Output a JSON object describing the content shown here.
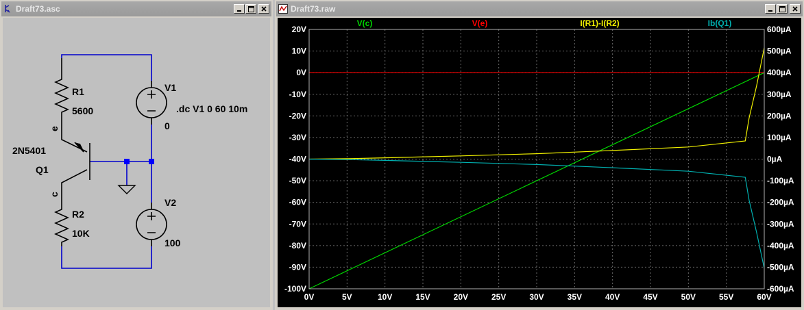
{
  "schematic_window": {
    "title": "Draft73.asc",
    "icon": "ltspice-app-icon",
    "buttons": [
      "minimize-icon",
      "maximize-icon",
      "close-icon"
    ],
    "components": {
      "r1_name": "R1",
      "r1_value": "5600",
      "r2_name": "R2",
      "r2_value": "10K",
      "v1_name": "V1",
      "v1_value": "0",
      "v2_name": "V2",
      "v2_value": "100",
      "q1_model": "2N5401",
      "q1_name": "Q1",
      "emitter_net": "e",
      "collector_net": "c",
      "directive": ".dc V1 0 60 10m"
    },
    "colors": {
      "background": "#c0c0c0",
      "wire": "#0000cc",
      "junction": "#0000ff",
      "component": "#000000"
    }
  },
  "waveform_window": {
    "title": "Draft73.raw",
    "icon": "waveform-app-icon",
    "buttons": [
      "minimize-icon",
      "maximize-icon",
      "close-icon"
    ],
    "colors": {
      "background": "#000000",
      "axis_text": "#ffffff",
      "grid": "#707070"
    }
  },
  "chart_data": {
    "type": "line",
    "grid": true,
    "legend_placement": "top",
    "x": {
      "label": "",
      "range": [
        0,
        60
      ],
      "ticks": [
        "0V",
        "5V",
        "10V",
        "15V",
        "20V",
        "25V",
        "30V",
        "35V",
        "40V",
        "45V",
        "50V",
        "55V",
        "60V"
      ]
    },
    "y_left": {
      "range": [
        -100,
        20
      ],
      "unit": "V",
      "ticks": [
        "20V",
        "10V",
        "0V",
        "-10V",
        "-20V",
        "-30V",
        "-40V",
        "-50V",
        "-60V",
        "-70V",
        "-80V",
        "-90V",
        "-100V"
      ]
    },
    "y_right": {
      "range": [
        -600,
        600
      ],
      "unit": "µA",
      "ticks": [
        "600µA",
        "500µA",
        "400µA",
        "300µA",
        "200µA",
        "100µA",
        "0µA",
        "-100µA",
        "-200µA",
        "-300µA",
        "-400µA",
        "-500µA",
        "-600µA"
      ]
    },
    "series": [
      {
        "name": "V(c)",
        "color": "#00d400",
        "axis": "left",
        "points": [
          [
            0,
            -100
          ],
          [
            60,
            0
          ]
        ]
      },
      {
        "name": "V(e)",
        "color": "#ff0000",
        "axis": "left",
        "points": [
          [
            0,
            0
          ],
          [
            60,
            0
          ]
        ]
      },
      {
        "name": "I(R1)-I(R2)",
        "color": "#f0f000",
        "axis": "right",
        "points": [
          [
            0,
            0
          ],
          [
            5,
            2
          ],
          [
            10,
            6
          ],
          [
            20,
            15
          ],
          [
            30,
            25
          ],
          [
            40,
            40
          ],
          [
            50,
            56
          ],
          [
            57.5,
            84
          ],
          [
            58,
            190
          ],
          [
            59,
            340
          ],
          [
            60,
            515
          ]
        ]
      },
      {
        "name": "Ib(Q1)",
        "color": "#00b0b0",
        "axis": "right",
        "points": [
          [
            0,
            0
          ],
          [
            5,
            -2
          ],
          [
            10,
            -6
          ],
          [
            20,
            -15
          ],
          [
            30,
            -25
          ],
          [
            40,
            -40
          ],
          [
            50,
            -56
          ],
          [
            57.5,
            -84
          ],
          [
            58,
            -190
          ],
          [
            59,
            -340
          ],
          [
            60,
            -505
          ]
        ]
      }
    ]
  }
}
